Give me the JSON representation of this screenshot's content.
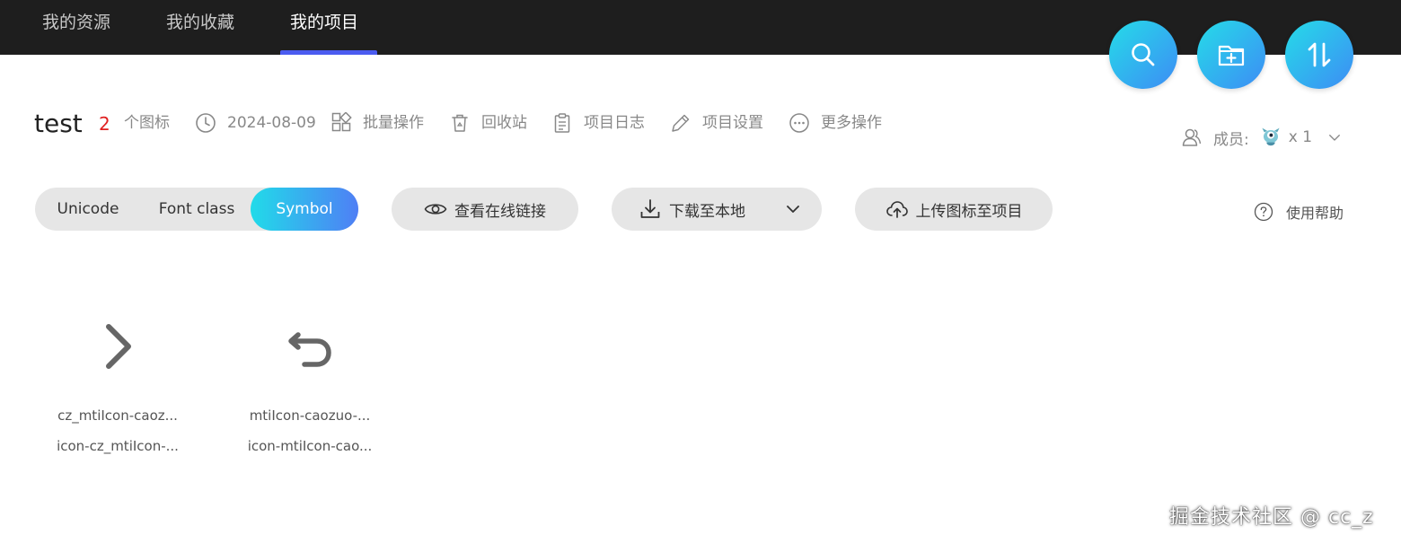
{
  "nav": {
    "tabs": [
      {
        "label": "我的资源"
      },
      {
        "label": "我的收藏"
      },
      {
        "label": "我的项目",
        "active": true
      }
    ]
  },
  "fabs": [
    {
      "icon": "search-icon"
    },
    {
      "icon": "add-folder-icon"
    },
    {
      "icon": "sort-icon"
    }
  ],
  "project": {
    "name": "test",
    "icon_count": "2",
    "icon_count_suffix": "个图标",
    "date": "2024-08-09",
    "actions": {
      "batch": "批量操作",
      "recycle": "回收站",
      "log": "项目日志",
      "settings": "项目设置",
      "more": "更多操作"
    },
    "members_label": "成员:",
    "members_count": "x 1"
  },
  "toolbar": {
    "segments": [
      {
        "label": "Unicode"
      },
      {
        "label": "Font class"
      },
      {
        "label": "Symbol",
        "active": true
      }
    ],
    "view_link": "查看在线链接",
    "download": "下载至本地",
    "upload": "上传图标至项目",
    "help": "使用帮助"
  },
  "icons": [
    {
      "name": "cz_mtiIcon-caoz...",
      "class_name": "icon-cz_mtiIcon-...",
      "glyph": "chevron-right-icon"
    },
    {
      "name": "mtiIcon-caozuo-...",
      "class_name": "icon-mtiIcon-cao...",
      "glyph": "undo-icon"
    }
  ],
  "watermark": "掘金技术社区 @ cc_z",
  "colors": {
    "topbar_bg": "#1e1e1e",
    "active_underline": "#4b5cf0",
    "accent_gradient_start": "#21dbe9",
    "accent_gradient_end": "#4f7ff5",
    "icon_count": "#e02020"
  }
}
